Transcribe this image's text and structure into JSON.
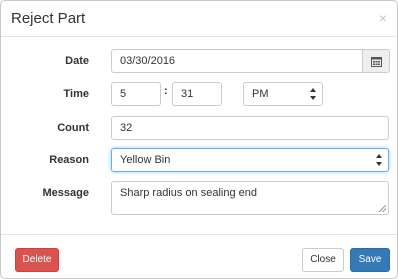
{
  "dialog": {
    "title": "Reject Part",
    "close_symbol": "×"
  },
  "form": {
    "date": {
      "label": "Date",
      "value": "03/30/2016",
      "addon_icon": "calendar-icon"
    },
    "time": {
      "label": "Time",
      "hour": "5",
      "separator": ":",
      "minute": "31",
      "period": "PM"
    },
    "count": {
      "label": "Count",
      "value": "32"
    },
    "reason": {
      "label": "Reason",
      "value": "Yellow Bin"
    },
    "message": {
      "label": "Message",
      "value": "Sharp radius on sealing end"
    }
  },
  "footer": {
    "delete_label": "Delete",
    "close_label": "Close",
    "save_label": "Save"
  },
  "colors": {
    "danger": "#d9534f",
    "primary": "#337ab7",
    "focus": "#66afe9"
  }
}
